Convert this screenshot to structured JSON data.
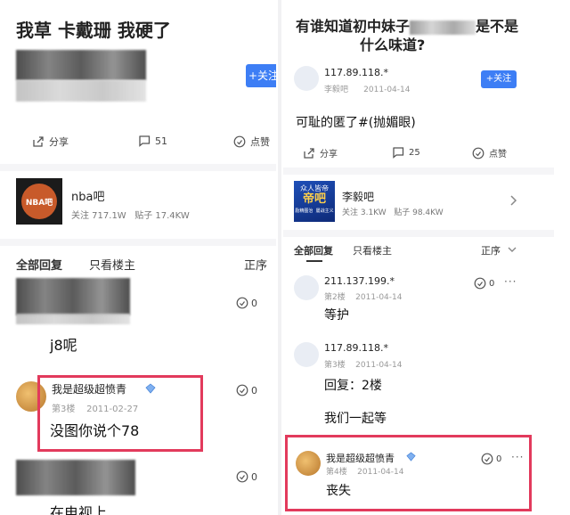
{
  "left": {
    "title": "我草 卡戴珊 我硬了",
    "follow_label": "+关注",
    "actions": {
      "share": "分享",
      "comments": "51",
      "like": "点赞"
    },
    "forum": {
      "name": "nba吧",
      "stats": "关注 717.1W   贴子 17.4KW",
      "logo_text": "NBA吧"
    },
    "tabs": {
      "all": "全部回复",
      "op_only": "只看楼主",
      "order": "正序"
    },
    "reply1": {
      "likes": "0",
      "text": "j8呢"
    },
    "reply2": {
      "username": "我是超级超愤青",
      "meta": "第3楼    2011-02-27",
      "text": "没图你说个78",
      "likes": "0"
    },
    "reply3": {
      "likes": "0",
      "text": "在电视上"
    }
  },
  "right": {
    "title_line1_a": "有谁知道初中妹子",
    "title_line1_b": "是不是",
    "title_line2": "什么味道?",
    "op": {
      "ip": "117.89.118.*",
      "meta": "李毅吧      2011-04-14",
      "follow_label": "+关注"
    },
    "post_text": "可耻的匿了#(抛媚眼)",
    "actions": {
      "share": "分享",
      "comments": "25",
      "like": "点赞"
    },
    "forum": {
      "name": "李毅吧",
      "stats": "关注 3.1KW   贴子 98.4KW",
      "logo_line1": "众人皆帝",
      "logo_line2": "帝吧",
      "logo_line3": "励精图治  屡战主义"
    },
    "tabs": {
      "all": "全部回复",
      "op_only": "只看楼主",
      "order": "正序"
    },
    "reply1": {
      "ip": "211.137.199.*",
      "meta": "第2楼    2011-04-14",
      "text": "等护",
      "likes": "0"
    },
    "reply2": {
      "ip": "117.89.118.*",
      "meta": "第3楼    2011-04-14",
      "text1": "回复：2楼",
      "text2": "我们一起等"
    },
    "reply3": {
      "username": "我是超级超愤青",
      "meta": "第4楼    2011-04-14",
      "text": "丧失",
      "likes": "0"
    }
  }
}
